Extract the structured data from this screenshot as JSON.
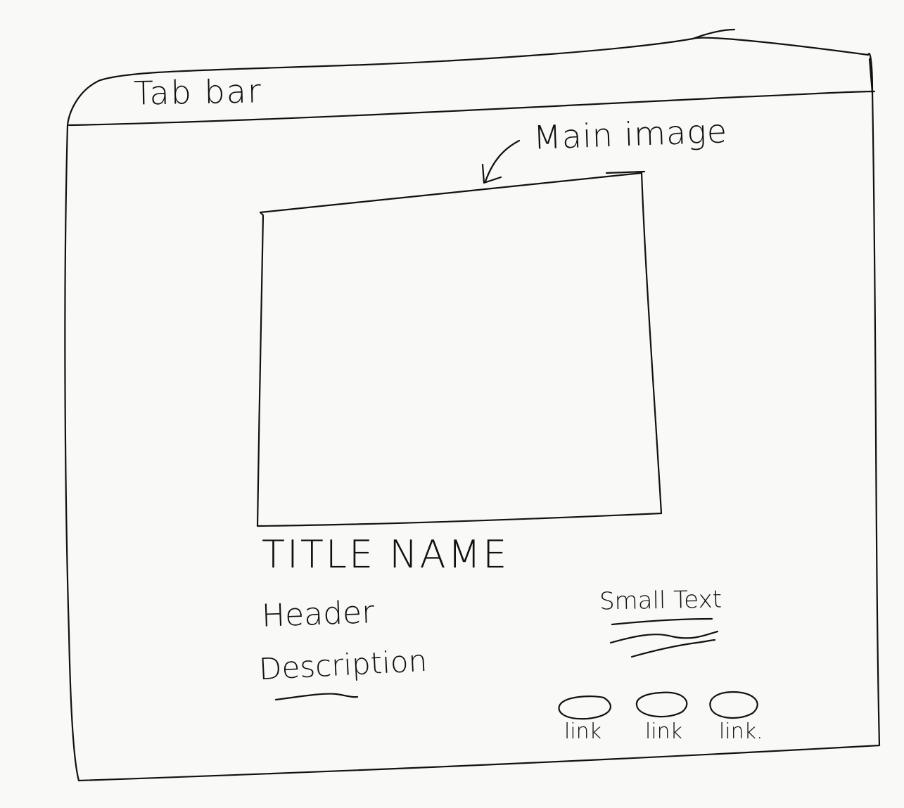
{
  "tab_bar": {
    "label": "Tab bar"
  },
  "main_image": {
    "annotation": "Main image"
  },
  "content": {
    "title": "TITLE NAME",
    "header": "Header",
    "description": "Description"
  },
  "side": {
    "small_text": "Small Text"
  },
  "links": [
    {
      "label": "link",
      "icon": "circle-icon"
    },
    {
      "label": "link",
      "icon": "circle-icon"
    },
    {
      "label": "link.",
      "icon": "circle-icon"
    }
  ],
  "colors": {
    "ink": "#111111",
    "paper": "#f9f9f8"
  }
}
